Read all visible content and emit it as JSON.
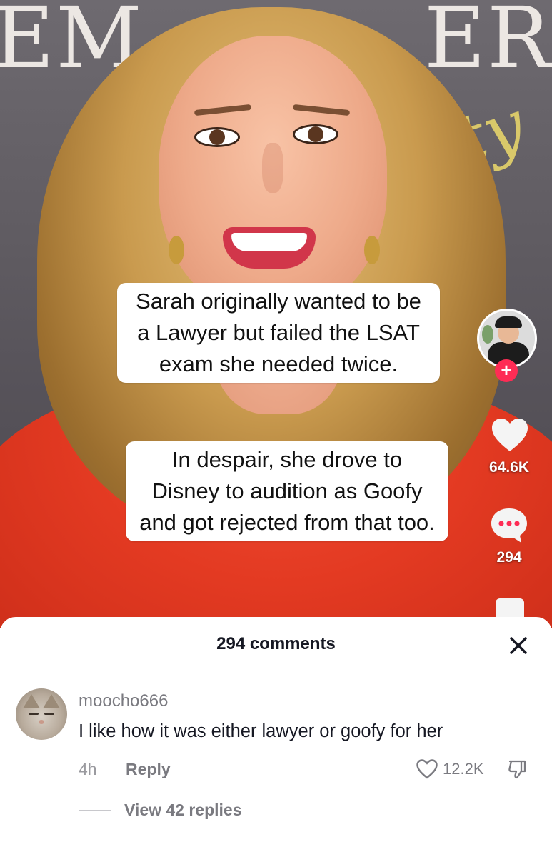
{
  "video": {
    "caption_1": "Sarah originally wanted to be a Lawyer but failed the LSAT exam she needed twice.",
    "caption_2": "In despair, she drove to Disney to audition as Goofy and got rejected from that too.",
    "backdrop_letters_left": "EM",
    "backdrop_letters_right": "ER",
    "backdrop_script": "ty",
    "follow_symbol": "+",
    "like_count": "64.6K",
    "comment_count": "294"
  },
  "comments_sheet": {
    "title": "294 comments",
    "close_symbol": "✕",
    "comment": {
      "username": "moocho666",
      "text": "I like how it was either lawyer or goofy for her",
      "time": "4h",
      "reply_label": "Reply",
      "like_count": "12.2K",
      "view_replies_label": "View 42 replies"
    }
  },
  "colors": {
    "accent_follow": "#fe2c55",
    "shirt_red": "#e33a22",
    "text_primary": "#161823",
    "text_secondary": "#7a7a80"
  },
  "icons": [
    "heart-icon",
    "comment-icon",
    "close-icon",
    "heart-outline-icon",
    "dislike-icon",
    "plus-icon"
  ]
}
